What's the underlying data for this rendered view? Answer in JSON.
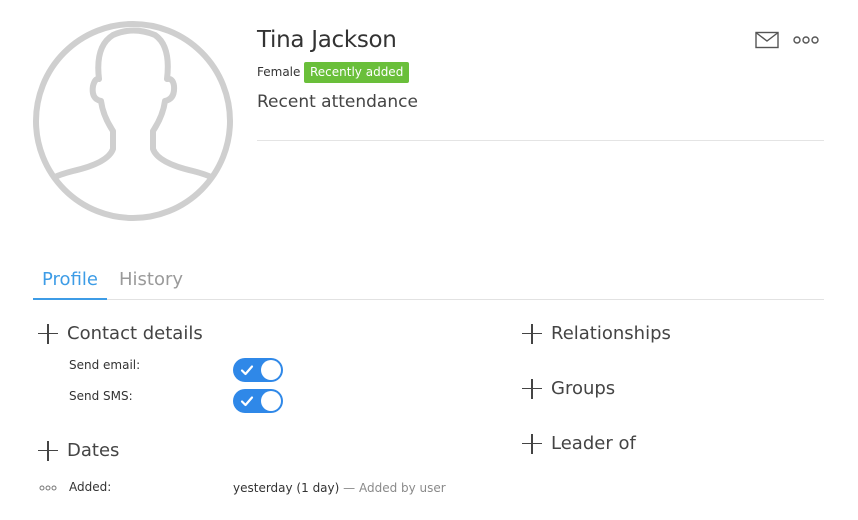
{
  "person": {
    "name": "Tina Jackson",
    "gender": "Female",
    "badge": "Recently added",
    "subtitle": "Recent attendance"
  },
  "actions": {
    "mail_icon": "envelope-icon",
    "more_icon": "more-dots-icon"
  },
  "tabs": [
    {
      "label": "Profile",
      "active": true
    },
    {
      "label": "History",
      "active": false
    }
  ],
  "left_sections": {
    "contact": {
      "title": "Contact details",
      "fields": [
        {
          "label": "Send email:",
          "value": true
        },
        {
          "label": "Send SMS:",
          "value": true
        }
      ]
    },
    "dates": {
      "title": "Dates",
      "rows": [
        {
          "label": "Added:",
          "value": "yesterday (1 day)",
          "separator": " — ",
          "note": "Added by user"
        }
      ]
    }
  },
  "right_sections": [
    {
      "title": "Relationships"
    },
    {
      "title": "Groups"
    },
    {
      "title": "Leader of"
    }
  ],
  "colors": {
    "accent": "#3d9ce6",
    "toggle_on": "#2f88e8",
    "badge": "#6abf3a",
    "avatar": "#cfcfcf",
    "divider": "#e4e4e4",
    "tab_inactive": "#9a9a9a",
    "icon": "#555555"
  }
}
